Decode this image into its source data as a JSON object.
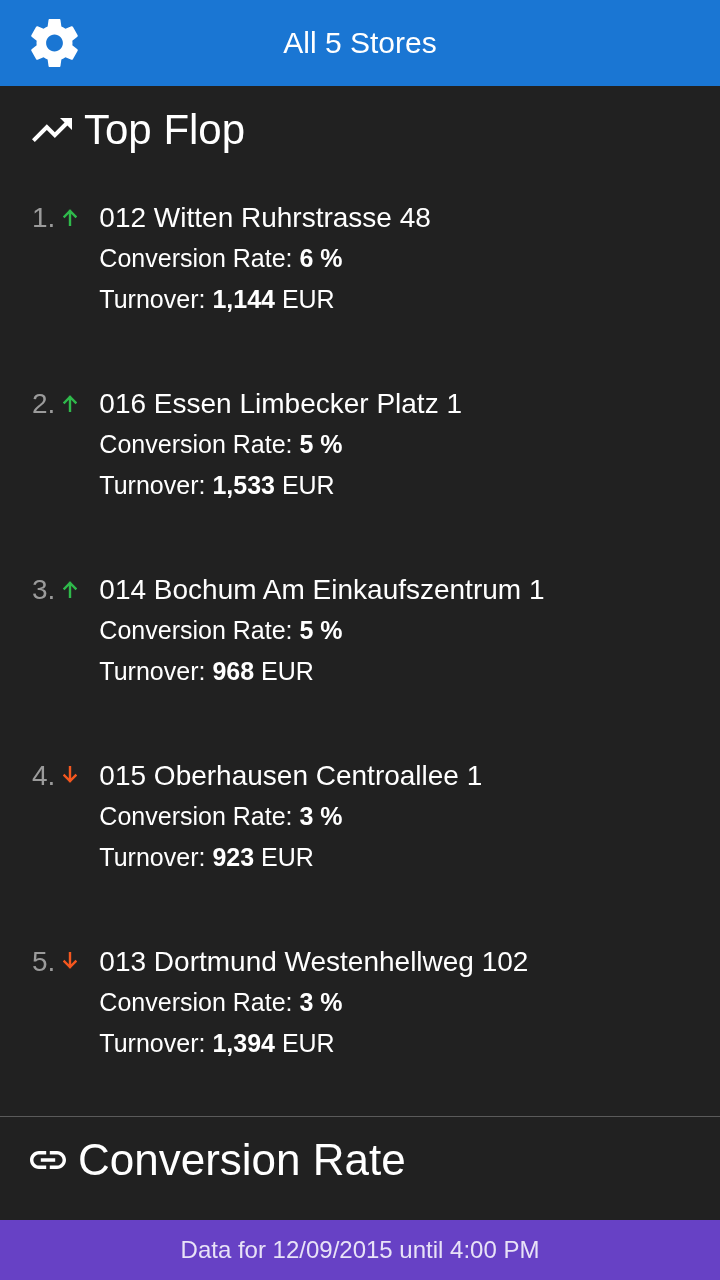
{
  "header": {
    "title": "All 5 Stores"
  },
  "top_flop": {
    "title": "Top Flop",
    "items": [
      {
        "rank": "1.",
        "trend_up": true,
        "name": "012 Witten Ruhrstrasse 48",
        "lines": [
          "Conversion Rate: **6 %**",
          "Turnover: **1,144** EUR"
        ]
      },
      {
        "rank": "2.",
        "trend_up": true,
        "name": "016 Essen Limbecker Platz 1",
        "lines": [
          "Conversion Rate: **5 %**",
          "Turnover: **1,533** EUR"
        ]
      },
      {
        "rank": "3.",
        "trend_up": true,
        "name": "014 Bochum Am Einkaufszentrum 1",
        "lines": [
          "Conversion Rate: **5 %**",
          "Turnover: **968** EUR"
        ]
      },
      {
        "rank": "4.",
        "trend_up": false,
        "name": "015 Oberhausen Centroallee 1",
        "lines": [
          "Conversion Rate: **3 %**",
          "Turnover: **923** EUR"
        ]
      },
      {
        "rank": "5.",
        "trend_up": false,
        "name": "013 Dortmund Westenhellweg 102",
        "lines": [
          "Conversion Rate: **3 %**",
          "Turnover: **1,394** EUR"
        ]
      }
    ]
  },
  "conversion_rate": {
    "title": "Conversion Rate"
  },
  "footer": {
    "text": "Data for 12/09/2015 until 4:00 PM"
  }
}
